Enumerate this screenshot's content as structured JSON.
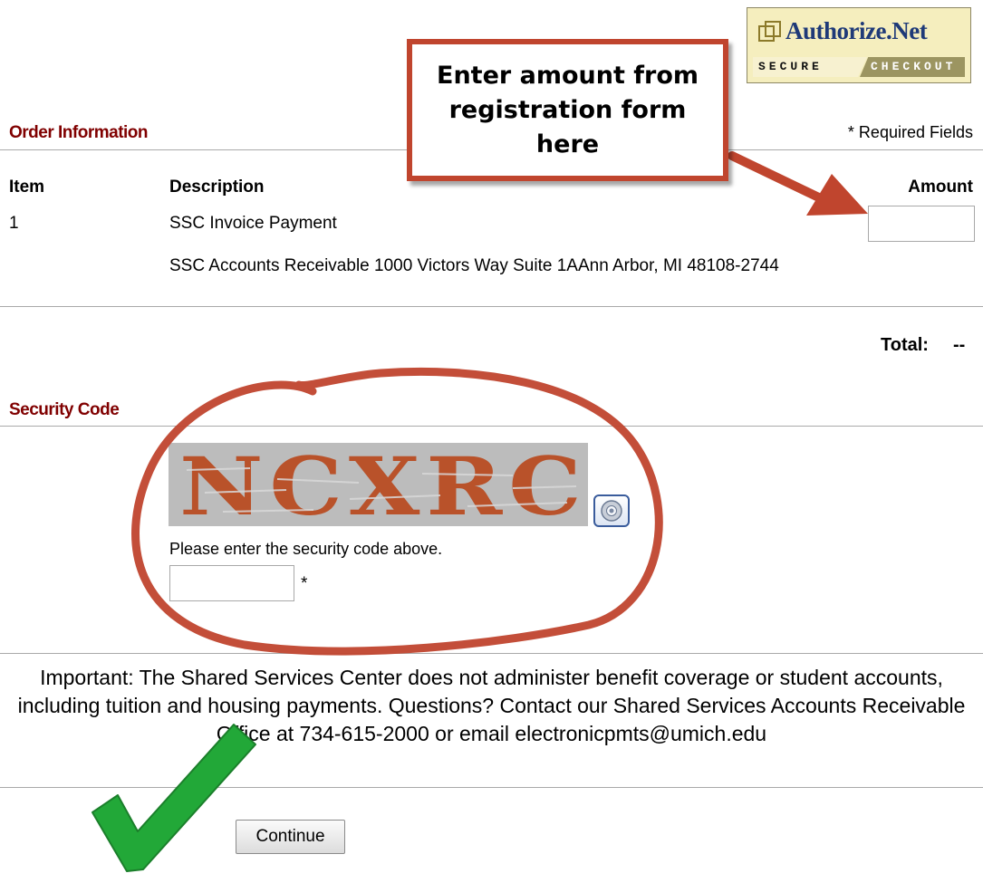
{
  "badge": {
    "brand": "Authorize.Net",
    "secure": "SECURE",
    "checkout": "CHECKOUT"
  },
  "callout": {
    "text": "Enter amount from registration form here"
  },
  "order": {
    "section_title": "Order Information",
    "required_note": "* Required Fields",
    "columns": {
      "item": "Item",
      "description": "Description",
      "amount": "Amount"
    },
    "row": {
      "item": "1",
      "description": "SSC Invoice Payment",
      "detail": "SSC Accounts Receivable 1000 Victors Way Suite 1AAnn Arbor, MI 48108-2744",
      "amount_value": ""
    },
    "total_label": "Total:",
    "total_value": "--"
  },
  "security": {
    "section_title": "Security Code",
    "captcha_text": "NCXRC",
    "prompt": "Please enter the security code above.",
    "required_mark": "*",
    "code_value": ""
  },
  "notice": {
    "text": "Important: The Shared Services Center does not administer benefit coverage or student accounts, including tuition and housing payments. Questions? Contact our Shared Services Accounts Receivable Office at 734-615-2000 or email electronicpmts@umich.edu"
  },
  "actions": {
    "continue_label": "Continue"
  },
  "colors": {
    "section_title": "#800000",
    "annotation_red": "#c0452e",
    "checkmark_green": "#22a838",
    "captcha_bg": "#bcbcbc"
  },
  "icons": {
    "audio": "speaker-icon",
    "badge_logo": "authorize-net-logo"
  }
}
